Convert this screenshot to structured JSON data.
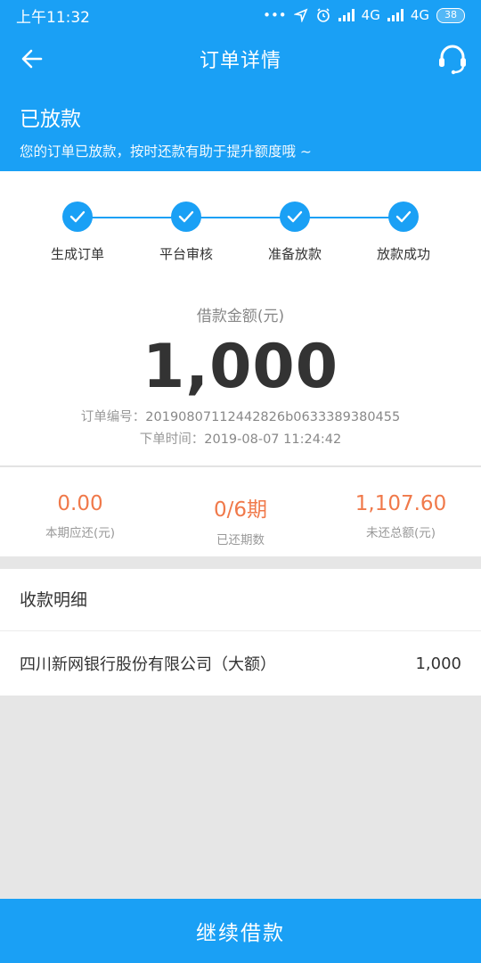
{
  "status_bar": {
    "time": "上午11:32",
    "network1": "4G",
    "network2": "4G",
    "battery": "38"
  },
  "nav": {
    "title": "订单详情"
  },
  "status": {
    "title": "已放款",
    "subtitle": "您的订单已放款，按时还款有助于提升额度哦 ~"
  },
  "steps": [
    {
      "label": "生成订单"
    },
    {
      "label": "平台审核"
    },
    {
      "label": "准备放款"
    },
    {
      "label": "放款成功"
    }
  ],
  "loan": {
    "amount_label": "借款金额(元)",
    "amount": "1,000",
    "order_no_label": "订单编号：",
    "order_no": "20190807112442826b0633389380455",
    "order_time_label": "下单时间：",
    "order_time": "2019-08-07 11:24:42"
  },
  "stats": [
    {
      "value": "0.00",
      "label": "本期应还(元)"
    },
    {
      "value": "0/6期",
      "label": "已还期数"
    },
    {
      "value": "1,107.60",
      "label": "未还总额(元)"
    }
  ],
  "receipt": {
    "title": "收款明细",
    "bank": "四川新网银行股份有限公司（大额）",
    "amount": "1,000"
  },
  "bottom_button": {
    "label": "继续借款"
  },
  "colors": {
    "primary": "#1aa0f5",
    "accent": "#f0794a"
  }
}
